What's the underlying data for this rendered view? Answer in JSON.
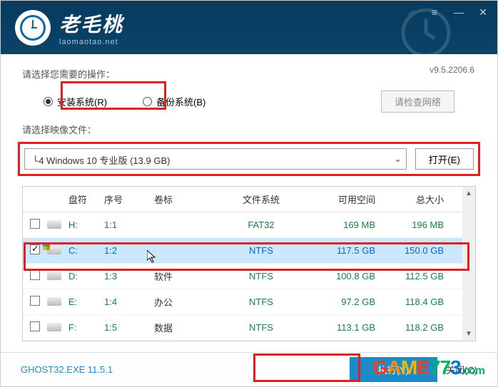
{
  "brand": {
    "zh": "老毛桃",
    "url": "laomaotao.net"
  },
  "wincontrols": {
    "set": "≡",
    "min": "—",
    "close": "✕"
  },
  "version": "v9.5.2206.6",
  "section_op": "请选择您需要的操作：",
  "radio_install": "安装系统(R)",
  "radio_backup": "备份系统(B)",
  "btn_check_net": "请检查网络",
  "section_image": "请选择映像文件：",
  "image_selected": "└4 Windows 10 专业版 (13.9 GB)",
  "btn_open": "打开(E)",
  "cols": {
    "drive": "盘符",
    "seq": "序号",
    "label": "卷标",
    "fs": "文件系统",
    "free": "可用空间",
    "total": "总大小"
  },
  "rows": [
    {
      "chk": false,
      "win": false,
      "drv": "H:",
      "seq": "1:1",
      "label": "",
      "fs": "FAT32",
      "free": "169 MB",
      "total": "196 MB",
      "sel": false
    },
    {
      "chk": true,
      "win": true,
      "drv": "C:",
      "seq": "1:2",
      "label": "",
      "fs": "NTFS",
      "free": "117.5 GB",
      "total": "150.0 GB",
      "sel": true
    },
    {
      "chk": false,
      "win": false,
      "drv": "D:",
      "seq": "1:3",
      "label": "软件",
      "fs": "NTFS",
      "free": "100.8 GB",
      "total": "112.5 GB",
      "sel": false
    },
    {
      "chk": false,
      "win": false,
      "drv": "E:",
      "seq": "1:4",
      "label": "办公",
      "fs": "NTFS",
      "free": "97.2 GB",
      "total": "118.4 GB",
      "sel": false
    },
    {
      "chk": false,
      "win": false,
      "drv": "F:",
      "seq": "1:5",
      "label": "数据",
      "fs": "NTFS",
      "free": "113.1 GB",
      "total": "118.2 GB",
      "sel": false
    }
  ],
  "footer": "GHOST32.EXE 11.5.1",
  "btn_exec": "执行(Y)",
  "btn_close": "关闭(C)",
  "watermark": {
    "g": "G",
    "a": "A",
    "m": "M",
    "e": "E",
    "n7": "7",
    "n72": "7",
    "n3": "3",
    "dot": ".",
    "com": "com"
  }
}
